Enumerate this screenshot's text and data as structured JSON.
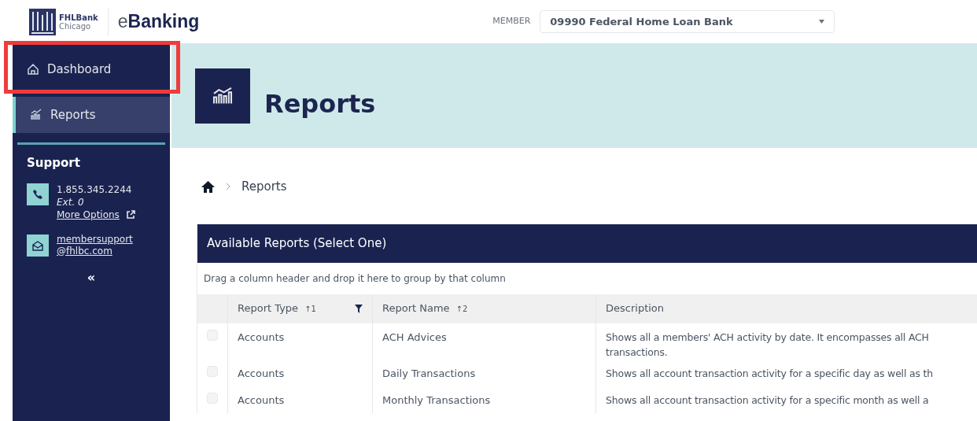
{
  "header": {
    "logo_top": "FHLBank",
    "logo_bottom": "Chicago",
    "app_name_prefix": "e",
    "app_name": "Banking",
    "member_label": "MEMBER",
    "member_value": "09990 Federal Home Loan Bank"
  },
  "sidebar": {
    "items": [
      {
        "label": "Dashboard",
        "selected": false,
        "highlighted": true
      },
      {
        "label": "Reports",
        "selected": true,
        "highlighted": false
      }
    ],
    "support": {
      "title": "Support",
      "phone": "1.855.345.2244",
      "ext": "Ext. 0",
      "more_options": "More Options",
      "email_lines": [
        "membersupport",
        "@fhlbc.com"
      ]
    },
    "collapse": "«"
  },
  "page_title": "Reports",
  "breadcrumb": [
    "Reports"
  ],
  "table": {
    "title": "Available Reports (Select One)",
    "group_hint": "Drag a column header and drop it here to group by that column",
    "columns": [
      {
        "label": "Report Type",
        "sort": "↑1",
        "filter": true
      },
      {
        "label": "Report Name",
        "sort": "↑2",
        "filter": false
      },
      {
        "label": "Description",
        "filter": false
      }
    ],
    "rows": [
      {
        "checked": false,
        "type": "Accounts",
        "name": "ACH Advices",
        "description": [
          "Shows all a members' ACH activity by date. It encompasses all ACH",
          "transactions."
        ]
      },
      {
        "checked": false,
        "type": "Accounts",
        "name": "Daily Transactions",
        "description": [
          "Shows all account transaction activity for a specific day as well as th"
        ]
      },
      {
        "checked": false,
        "type": "Accounts",
        "name": "Monthly Transactions",
        "description": [
          "Shows all account transaction activity for a specific month as well a"
        ]
      }
    ]
  }
}
